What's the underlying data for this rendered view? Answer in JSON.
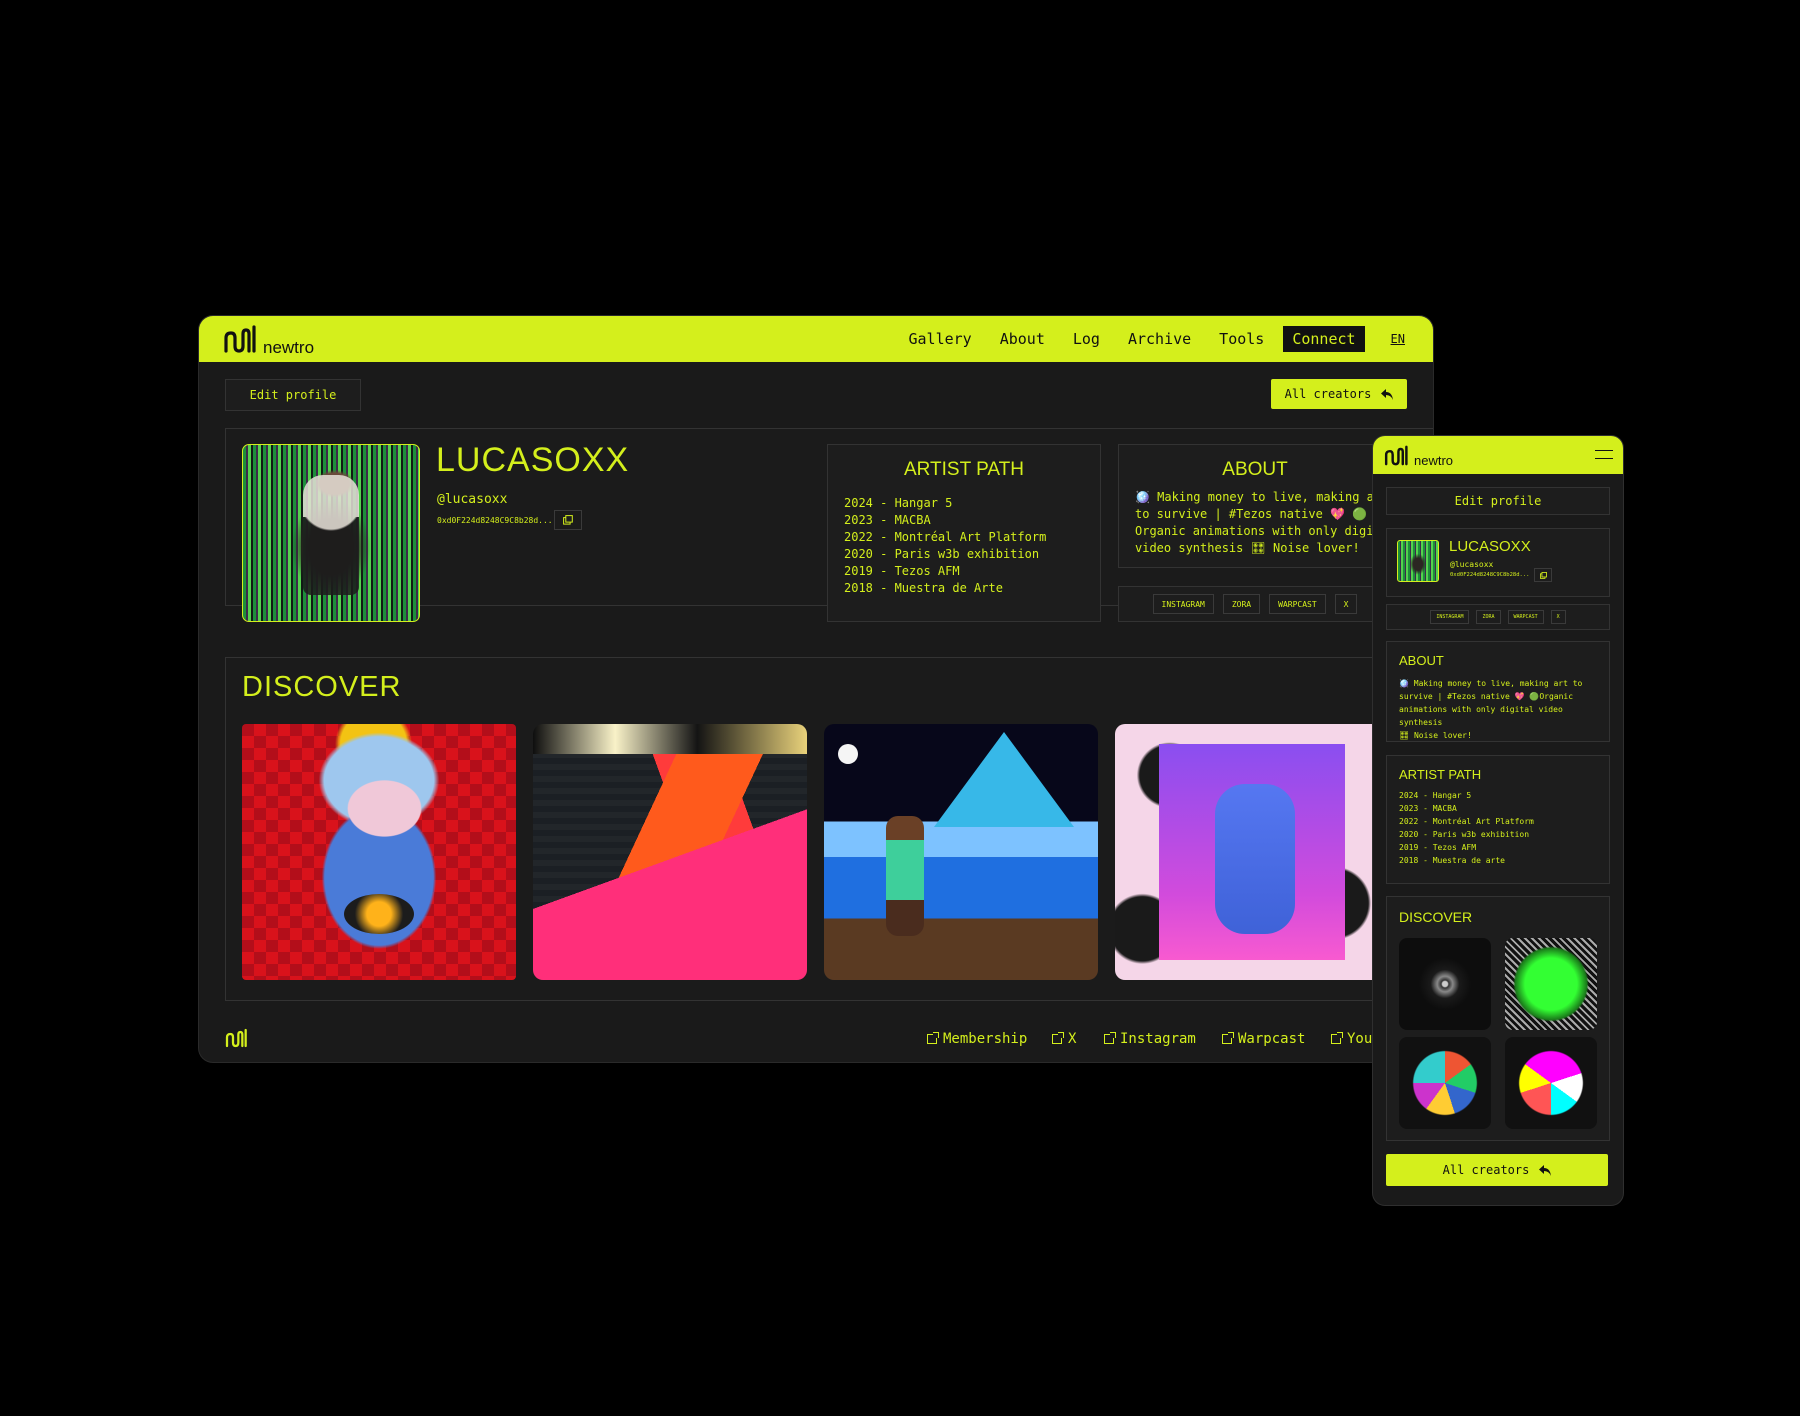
{
  "brand": {
    "name": "newtro"
  },
  "nav": {
    "items": [
      "Gallery",
      "About",
      "Log",
      "Archive",
      "Tools"
    ],
    "connect": "Connect",
    "lang": "EN"
  },
  "toolbar": {
    "edit_profile": "Edit profile",
    "all_creators": "All creators"
  },
  "profile": {
    "name": "LUCASOXX",
    "handle": "@lucasoxx",
    "wallet": "0xd0F224d8248C9C8b28d...",
    "wallet_mobile": "0xd0F224d8248C9C8b28d..."
  },
  "artist_path": {
    "title": "ARTIST PATH",
    "entries": [
      "2024 - Hangar 5",
      "2023 - MACBA",
      "2022 - Montréal Art Platform",
      "2020 - Paris w3b exhibition",
      "2019 - Tezos AFM",
      "2018 - Muestra de Arte"
    ],
    "mobile_entries": [
      "2024 - Hangar 5",
      "2023 - MACBA",
      "2022 - Montréal Art Platform",
      "2020 - Paris w3b exhibition",
      "2019 - Tezos AFM",
      "2018 - Muestra de arte"
    ]
  },
  "about": {
    "title": "ABOUT",
    "lines": [
      "🪩 Making money to live, making art",
      "to survive | #Tezos native 💖 🟢",
      "Organic animations with only digital",
      "video synthesis 🎛 Noise lover!"
    ],
    "mobile_lines": [
      "🪩 Making money to live, making art to",
      "survive | #Tezos native 💖 🟢Organic",
      "animations with only digital video synthesis",
      "🎛 Noise lover!"
    ]
  },
  "socials": [
    "INSTAGRAM",
    "ZORA",
    "WARPCAST",
    "X"
  ],
  "discover": {
    "title": "DISCOVER"
  },
  "footer": {
    "links": [
      "Membership",
      "X",
      "Instagram",
      "Warpcast",
      "You"
    ]
  },
  "icons": {
    "copy": "copy-icon",
    "back": "back-arrow-icon",
    "menu": "hamburger-menu-icon",
    "external": "external-link-icon",
    "logo": "newtro-logo-icon"
  },
  "colors": {
    "accent": "#d4ef1c",
    "surface": "#1a1a1a",
    "background": "#000000"
  }
}
